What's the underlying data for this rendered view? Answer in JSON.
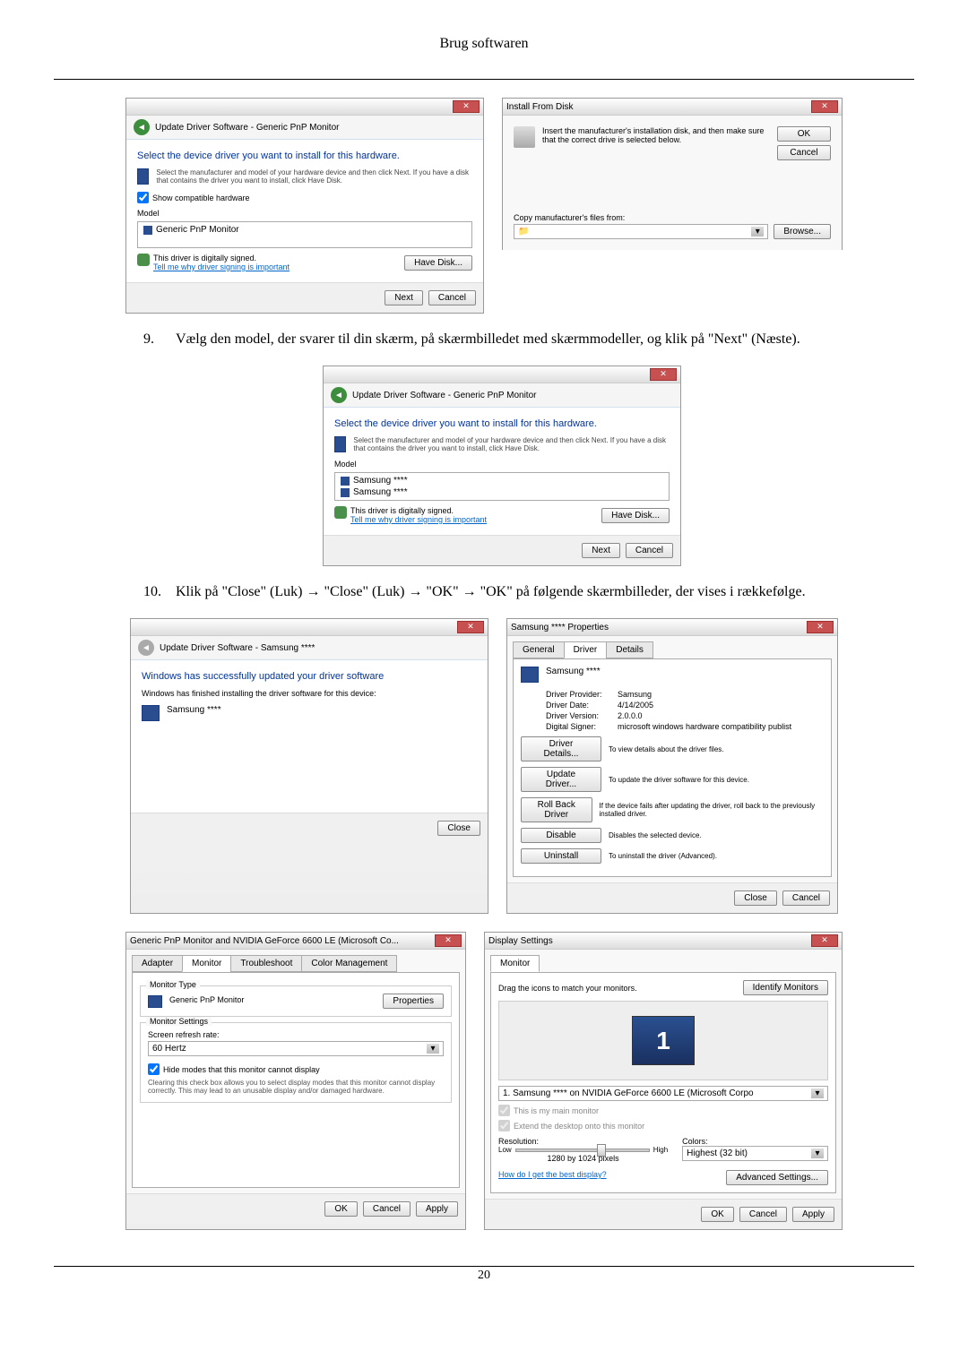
{
  "header": "Brug softwaren",
  "step9": {
    "num": "9.",
    "text": "Vælg den model, der svarer til din skærm, på skærmbilledet med skærmmodeller, og klik på \"Next\" (Næste)."
  },
  "step10": {
    "num": "10.",
    "text": "Klik på \"Close\" (Luk) → \"Close\" (Luk) → \"OK\" → \"OK\" på følgende skærmbilleder, der vises i rækkefølge."
  },
  "dialog1": {
    "breadcrumb": "Update Driver Software - Generic PnP Monitor",
    "title": "Select the device driver you want to install for this hardware.",
    "info": "Select the manufacturer and model of your hardware device and then click Next. If you have a disk that contains the driver you want to install, click Have Disk.",
    "showCompat": "Show compatible hardware",
    "modelLabel": "Model",
    "modelItem": "Generic PnP Monitor",
    "signed": "This driver is digitally signed.",
    "signedLink": "Tell me why driver signing is important",
    "haveDisk": "Have Disk...",
    "next": "Next",
    "cancel": "Cancel"
  },
  "dialog2": {
    "title": "Install From Disk",
    "info": "Insert the manufacturer's installation disk, and then make sure that the correct drive is selected below.",
    "ok": "OK",
    "cancel": "Cancel",
    "copyLabel": "Copy manufacturer's files from:",
    "browse": "Browse..."
  },
  "dialog3": {
    "breadcrumb": "Update Driver Software - Generic PnP Monitor",
    "title": "Select the device driver you want to install for this hardware.",
    "info": "Select the manufacturer and model of your hardware device and then click Next. If you have a disk that contains the driver you want to install, click Have Disk.",
    "modelLabel": "Model",
    "item1": "Samsung ****",
    "item2": "Samsung ****",
    "signed": "This driver is digitally signed.",
    "signedLink": "Tell me why driver signing is important",
    "haveDisk": "Have Disk...",
    "next": "Next",
    "cancel": "Cancel"
  },
  "dialog4": {
    "breadcrumb": "Update Driver Software - Samsung ****",
    "title": "Windows has successfully updated your driver software",
    "info": "Windows has finished installing the driver software for this device:",
    "device": "Samsung ****",
    "close": "Close"
  },
  "dialog5": {
    "title": "Samsung **** Properties",
    "tabGeneral": "General",
    "tabDriver": "Driver",
    "tabDetails": "Details",
    "device": "Samsung ****",
    "provider": "Driver Provider:",
    "providerVal": "Samsung",
    "date": "Driver Date:",
    "dateVal": "4/14/2005",
    "version": "Driver Version:",
    "versionVal": "2.0.0.0",
    "signer": "Digital Signer:",
    "signerVal": "microsoft windows hardware compatibility publist",
    "detailsBtn": "Driver Details...",
    "detailsDesc": "To view details about the driver files.",
    "updateBtn": "Update Driver...",
    "updateDesc": "To update the driver software for this device.",
    "rollBtn": "Roll Back Driver",
    "rollDesc": "If the device fails after updating the driver, roll back to the previously installed driver.",
    "disableBtn": "Disable",
    "disableDesc": "Disables the selected device.",
    "uninstallBtn": "Uninstall",
    "uninstallDesc": "To uninstall the driver (Advanced).",
    "close": "Close",
    "cancel": "Cancel"
  },
  "dialog6": {
    "title": "Generic PnP Monitor and NVIDIA GeForce 6600 LE (Microsoft Co...",
    "tabAdapter": "Adapter",
    "tabMonitor": "Monitor",
    "tabTroubleshoot": "Troubleshoot",
    "tabColor": "Color Management",
    "typeLabel": "Monitor Type",
    "typeName": "Generic PnP Monitor",
    "propBtn": "Properties",
    "settingsLabel": "Monitor Settings",
    "refreshLabel": "Screen refresh rate:",
    "refreshVal": "60 Hertz",
    "hideCheck": "Hide modes that this monitor cannot display",
    "hideDesc": "Clearing this check box allows you to select display modes that this monitor cannot display correctly. This may lead to an unusable display and/or damaged hardware.",
    "ok": "OK",
    "cancel": "Cancel",
    "apply": "Apply"
  },
  "dialog7": {
    "title": "Display Settings",
    "tabMonitor": "Monitor",
    "dragText": "Drag the icons to match your monitors.",
    "identify": "Identify Monitors",
    "monitorNum": "1",
    "monitorSel": "1. Samsung **** on NVIDIA GeForce 6600 LE (Microsoft Corpo",
    "mainCheck": "This is my main monitor",
    "extendCheck": "Extend the desktop onto this monitor",
    "resLabel": "Resolution:",
    "colorLabel": "Colors:",
    "low": "Low",
    "high": "High",
    "resVal": "1280 by 1024 pixels",
    "colorVal": "Highest (32 bit)",
    "helpLink": "How do I get the best display?",
    "advBtn": "Advanced Settings...",
    "ok": "OK",
    "cancel": "Cancel",
    "apply": "Apply"
  },
  "pageNum": "20"
}
